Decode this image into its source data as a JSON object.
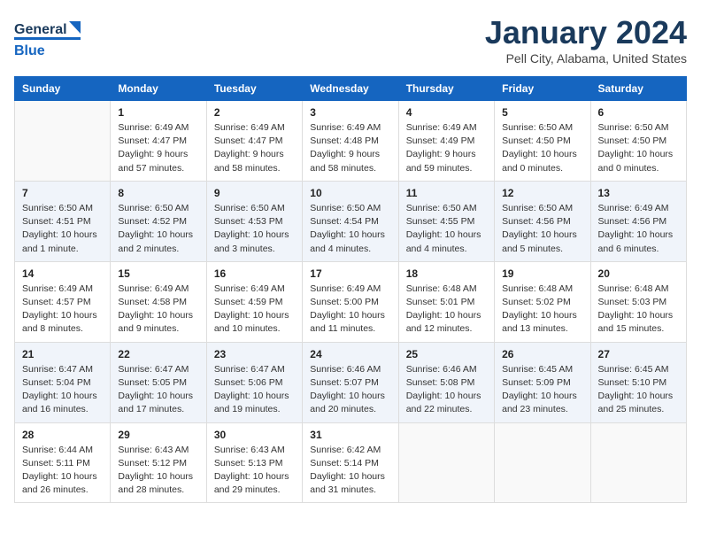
{
  "header": {
    "logo_general": "General",
    "logo_blue": "Blue",
    "month_title": "January 2024",
    "location": "Pell City, Alabama, United States"
  },
  "days_of_week": [
    "Sunday",
    "Monday",
    "Tuesday",
    "Wednesday",
    "Thursday",
    "Friday",
    "Saturday"
  ],
  "weeks": [
    [
      {
        "day": "",
        "sunrise": "",
        "sunset": "",
        "daylight": ""
      },
      {
        "day": "1",
        "sunrise": "Sunrise: 6:49 AM",
        "sunset": "Sunset: 4:47 PM",
        "daylight": "Daylight: 9 hours and 57 minutes."
      },
      {
        "day": "2",
        "sunrise": "Sunrise: 6:49 AM",
        "sunset": "Sunset: 4:47 PM",
        "daylight": "Daylight: 9 hours and 58 minutes."
      },
      {
        "day": "3",
        "sunrise": "Sunrise: 6:49 AM",
        "sunset": "Sunset: 4:48 PM",
        "daylight": "Daylight: 9 hours and 58 minutes."
      },
      {
        "day": "4",
        "sunrise": "Sunrise: 6:49 AM",
        "sunset": "Sunset: 4:49 PM",
        "daylight": "Daylight: 9 hours and 59 minutes."
      },
      {
        "day": "5",
        "sunrise": "Sunrise: 6:50 AM",
        "sunset": "Sunset: 4:50 PM",
        "daylight": "Daylight: 10 hours and 0 minutes."
      },
      {
        "day": "6",
        "sunrise": "Sunrise: 6:50 AM",
        "sunset": "Sunset: 4:50 PM",
        "daylight": "Daylight: 10 hours and 0 minutes."
      }
    ],
    [
      {
        "day": "7",
        "sunrise": "Sunrise: 6:50 AM",
        "sunset": "Sunset: 4:51 PM",
        "daylight": "Daylight: 10 hours and 1 minute."
      },
      {
        "day": "8",
        "sunrise": "Sunrise: 6:50 AM",
        "sunset": "Sunset: 4:52 PM",
        "daylight": "Daylight: 10 hours and 2 minutes."
      },
      {
        "day": "9",
        "sunrise": "Sunrise: 6:50 AM",
        "sunset": "Sunset: 4:53 PM",
        "daylight": "Daylight: 10 hours and 3 minutes."
      },
      {
        "day": "10",
        "sunrise": "Sunrise: 6:50 AM",
        "sunset": "Sunset: 4:54 PM",
        "daylight": "Daylight: 10 hours and 4 minutes."
      },
      {
        "day": "11",
        "sunrise": "Sunrise: 6:50 AM",
        "sunset": "Sunset: 4:55 PM",
        "daylight": "Daylight: 10 hours and 4 minutes."
      },
      {
        "day": "12",
        "sunrise": "Sunrise: 6:50 AM",
        "sunset": "Sunset: 4:56 PM",
        "daylight": "Daylight: 10 hours and 5 minutes."
      },
      {
        "day": "13",
        "sunrise": "Sunrise: 6:49 AM",
        "sunset": "Sunset: 4:56 PM",
        "daylight": "Daylight: 10 hours and 6 minutes."
      }
    ],
    [
      {
        "day": "14",
        "sunrise": "Sunrise: 6:49 AM",
        "sunset": "Sunset: 4:57 PM",
        "daylight": "Daylight: 10 hours and 8 minutes."
      },
      {
        "day": "15",
        "sunrise": "Sunrise: 6:49 AM",
        "sunset": "Sunset: 4:58 PM",
        "daylight": "Daylight: 10 hours and 9 minutes."
      },
      {
        "day": "16",
        "sunrise": "Sunrise: 6:49 AM",
        "sunset": "Sunset: 4:59 PM",
        "daylight": "Daylight: 10 hours and 10 minutes."
      },
      {
        "day": "17",
        "sunrise": "Sunrise: 6:49 AM",
        "sunset": "Sunset: 5:00 PM",
        "daylight": "Daylight: 10 hours and 11 minutes."
      },
      {
        "day": "18",
        "sunrise": "Sunrise: 6:48 AM",
        "sunset": "Sunset: 5:01 PM",
        "daylight": "Daylight: 10 hours and 12 minutes."
      },
      {
        "day": "19",
        "sunrise": "Sunrise: 6:48 AM",
        "sunset": "Sunset: 5:02 PM",
        "daylight": "Daylight: 10 hours and 13 minutes."
      },
      {
        "day": "20",
        "sunrise": "Sunrise: 6:48 AM",
        "sunset": "Sunset: 5:03 PM",
        "daylight": "Daylight: 10 hours and 15 minutes."
      }
    ],
    [
      {
        "day": "21",
        "sunrise": "Sunrise: 6:47 AM",
        "sunset": "Sunset: 5:04 PM",
        "daylight": "Daylight: 10 hours and 16 minutes."
      },
      {
        "day": "22",
        "sunrise": "Sunrise: 6:47 AM",
        "sunset": "Sunset: 5:05 PM",
        "daylight": "Daylight: 10 hours and 17 minutes."
      },
      {
        "day": "23",
        "sunrise": "Sunrise: 6:47 AM",
        "sunset": "Sunset: 5:06 PM",
        "daylight": "Daylight: 10 hours and 19 minutes."
      },
      {
        "day": "24",
        "sunrise": "Sunrise: 6:46 AM",
        "sunset": "Sunset: 5:07 PM",
        "daylight": "Daylight: 10 hours and 20 minutes."
      },
      {
        "day": "25",
        "sunrise": "Sunrise: 6:46 AM",
        "sunset": "Sunset: 5:08 PM",
        "daylight": "Daylight: 10 hours and 22 minutes."
      },
      {
        "day": "26",
        "sunrise": "Sunrise: 6:45 AM",
        "sunset": "Sunset: 5:09 PM",
        "daylight": "Daylight: 10 hours and 23 minutes."
      },
      {
        "day": "27",
        "sunrise": "Sunrise: 6:45 AM",
        "sunset": "Sunset: 5:10 PM",
        "daylight": "Daylight: 10 hours and 25 minutes."
      }
    ],
    [
      {
        "day": "28",
        "sunrise": "Sunrise: 6:44 AM",
        "sunset": "Sunset: 5:11 PM",
        "daylight": "Daylight: 10 hours and 26 minutes."
      },
      {
        "day": "29",
        "sunrise": "Sunrise: 6:43 AM",
        "sunset": "Sunset: 5:12 PM",
        "daylight": "Daylight: 10 hours and 28 minutes."
      },
      {
        "day": "30",
        "sunrise": "Sunrise: 6:43 AM",
        "sunset": "Sunset: 5:13 PM",
        "daylight": "Daylight: 10 hours and 29 minutes."
      },
      {
        "day": "31",
        "sunrise": "Sunrise: 6:42 AM",
        "sunset": "Sunset: 5:14 PM",
        "daylight": "Daylight: 10 hours and 31 minutes."
      },
      {
        "day": "",
        "sunrise": "",
        "sunset": "",
        "daylight": ""
      },
      {
        "day": "",
        "sunrise": "",
        "sunset": "",
        "daylight": ""
      },
      {
        "day": "",
        "sunrise": "",
        "sunset": "",
        "daylight": ""
      }
    ]
  ]
}
